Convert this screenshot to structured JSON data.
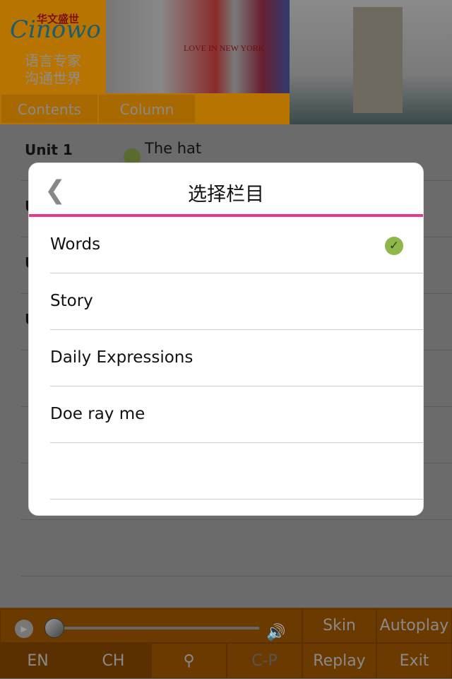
{
  "header": {
    "logo_cn": "华文盛世",
    "logo_brand": "Cinowo",
    "slogan_line1": "语言专家",
    "slogan_line2": "沟通世界",
    "banner_text": "LOVE IN NEW YORK",
    "tabs": [
      {
        "label": "Contents"
      },
      {
        "label": "Column"
      }
    ]
  },
  "list": {
    "rows": [
      {
        "unit": "Unit 1",
        "lesson": "The hat",
        "done": true
      },
      {
        "unit": "U"
      },
      {
        "unit": "U"
      },
      {
        "unit": "U"
      }
    ]
  },
  "dialog": {
    "title": "选择栏目",
    "back_icon": "chevron-left-icon",
    "options": [
      {
        "label": "Words",
        "selected": true
      },
      {
        "label": "Story",
        "selected": false
      },
      {
        "label": "Daily Expressions",
        "selected": false
      },
      {
        "label": "Doe ray me",
        "selected": false
      },
      {
        "label": "",
        "selected": false
      }
    ],
    "accent_color": "#e8388f",
    "check_color": "#8fb74a"
  },
  "player": {
    "progress": 0,
    "skin": "Skin",
    "autoplay": "Autoplay"
  },
  "toolbar": {
    "en": "EN",
    "ch": "CH",
    "search_icon": "search-icon",
    "cp": "C-P",
    "replay": "Replay",
    "exit": "Exit"
  }
}
